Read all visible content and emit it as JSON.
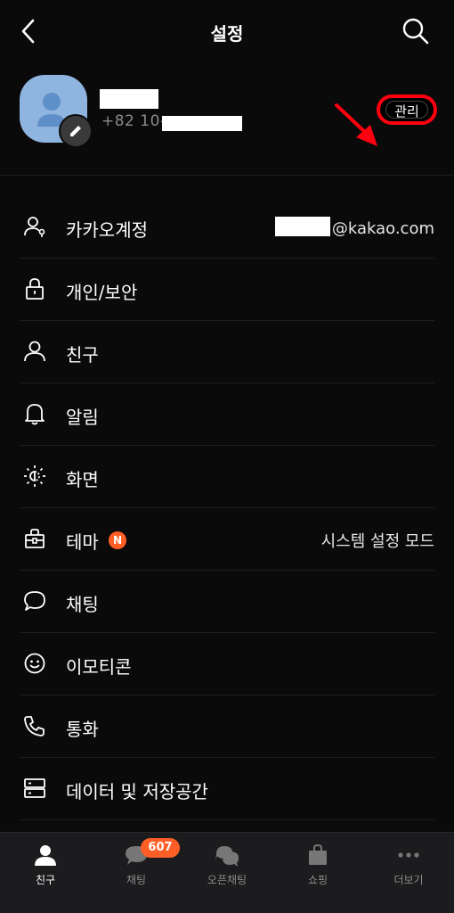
{
  "header": {
    "title": "설정"
  },
  "profile": {
    "phone": "+82 10-",
    "manage_label": "관리"
  },
  "menu": {
    "items": [
      {
        "label": "카카오계정",
        "value": "@kakao.com",
        "icon": "account-icon"
      },
      {
        "label": "개인/보안",
        "icon": "lock-icon"
      },
      {
        "label": "친구",
        "icon": "person-icon"
      },
      {
        "label": "알림",
        "icon": "bell-icon"
      },
      {
        "label": "화면",
        "icon": "display-icon"
      },
      {
        "label": "테마",
        "badge": "N",
        "value": "시스템 설정 모드",
        "icon": "theme-icon"
      },
      {
        "label": "채팅",
        "icon": "chat-bubble-icon"
      },
      {
        "label": "이모티콘",
        "icon": "emoticon-icon"
      },
      {
        "label": "통화",
        "icon": "phone-icon"
      },
      {
        "label": "데이터 및 저장공간",
        "icon": "storage-icon"
      }
    ]
  },
  "tabbar": {
    "tabs": [
      {
        "label": "친구",
        "active": true,
        "icon": "friends-icon"
      },
      {
        "label": "채팅",
        "badge": "607",
        "icon": "chat-icon"
      },
      {
        "label": "오픈채팅",
        "icon": "open-chat-icon"
      },
      {
        "label": "쇼핑",
        "icon": "shopping-bag-icon"
      },
      {
        "label": "더보기",
        "icon": "more-icon"
      }
    ]
  },
  "colors": {
    "accent": "#ff5f26",
    "annotation": "#ff0010",
    "avatar": "#8fb4df"
  }
}
